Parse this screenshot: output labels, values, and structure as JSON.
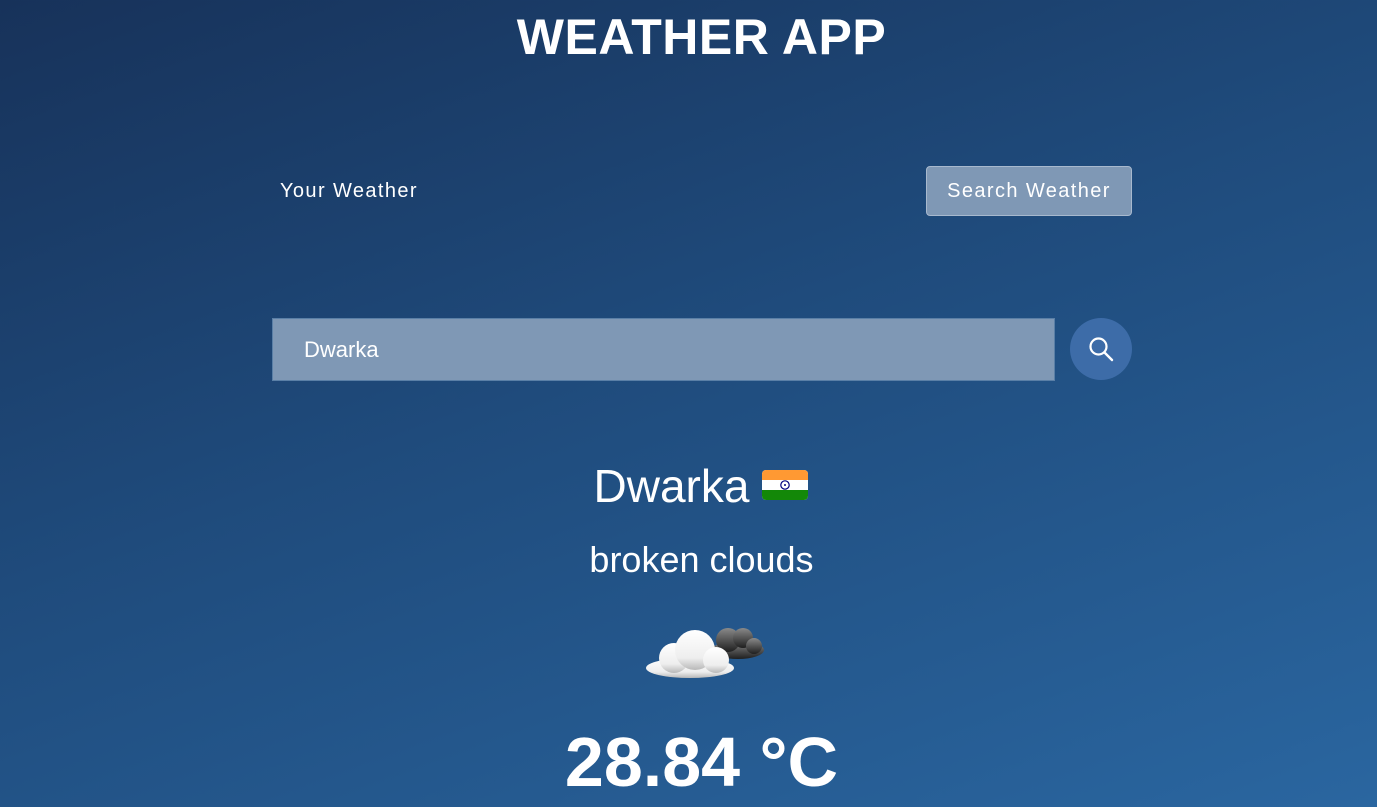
{
  "app": {
    "title": "WEATHER APP"
  },
  "tabs": {
    "your_weather": "Your Weather",
    "search_weather": "Search Weather"
  },
  "search": {
    "value": "Dwarka",
    "button_icon": "search-icon"
  },
  "weather": {
    "city": "Dwarka",
    "country_flag_icon": "india-flag-icon",
    "description": "broken clouds",
    "condition_icon": "broken-clouds-icon",
    "temperature": "28.84 °C"
  },
  "colors": {
    "background_top": "#17325a",
    "background_bottom": "#2a66a0",
    "input_background": "#7f98b5",
    "search_button": "#3d6ca8",
    "flag_saffron": "#ff9933",
    "flag_green": "#138808",
    "flag_chakra": "#000080"
  }
}
